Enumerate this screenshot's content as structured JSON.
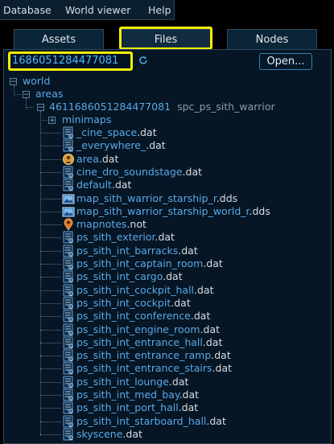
{
  "menu": [
    "Database",
    "World viewer",
    "Help"
  ],
  "tabs": [
    "Assets",
    "Files",
    "Nodes"
  ],
  "id_field": "1686051284477081",
  "open_label": "Open...",
  "tree": {
    "world": "world",
    "areas": "areas",
    "area_node": {
      "name": "4611686051284477081",
      "type": "spc_ps_sith_warrior"
    },
    "minimaps": "minimaps",
    "files": [
      {
        "stem": "_cine_space",
        "ext": ".dat",
        "icon": "scene-icon"
      },
      {
        "stem": "_everywhere_",
        "ext": ".dat",
        "icon": "scene-icon"
      },
      {
        "stem": "area",
        "ext": ".dat",
        "icon": "area-icon"
      },
      {
        "stem": "cine_dro_soundstage",
        "ext": ".dat",
        "icon": "scene-icon"
      },
      {
        "stem": "default",
        "ext": ".dat",
        "icon": "scene-icon"
      },
      {
        "stem": "map_sith_warrior_starship_r",
        "ext": ".dds",
        "icon": "image-icon"
      },
      {
        "stem": "map_sith_warrior_starship_world_r",
        "ext": ".dds",
        "icon": "image-icon"
      },
      {
        "stem": "mapnotes",
        "ext": ".not",
        "icon": "map-pin-icon"
      },
      {
        "stem": "ps_sith_exterior",
        "ext": ".dat",
        "icon": "scene-icon"
      },
      {
        "stem": "ps_sith_int_barracks",
        "ext": ".dat",
        "icon": "scene-icon"
      },
      {
        "stem": "ps_sith_int_captain_room",
        "ext": ".dat",
        "icon": "scene-icon"
      },
      {
        "stem": "ps_sith_int_cargo",
        "ext": ".dat",
        "icon": "scene-icon"
      },
      {
        "stem": "ps_sith_int_cockpit_hall",
        "ext": ".dat",
        "icon": "scene-icon"
      },
      {
        "stem": "ps_sith_int_cockpit",
        "ext": ".dat",
        "icon": "scene-icon"
      },
      {
        "stem": "ps_sith_int_conference",
        "ext": ".dat",
        "icon": "scene-icon"
      },
      {
        "stem": "ps_sith_int_engine_room",
        "ext": ".dat",
        "icon": "scene-icon"
      },
      {
        "stem": "ps_sith_int_entrance_hall",
        "ext": ".dat",
        "icon": "scene-icon"
      },
      {
        "stem": "ps_sith_int_entrance_ramp",
        "ext": ".dat",
        "icon": "scene-icon"
      },
      {
        "stem": "ps_sith_int_entrance_stairs",
        "ext": ".dat",
        "icon": "scene-icon"
      },
      {
        "stem": "ps_sith_int_lounge",
        "ext": ".dat",
        "icon": "scene-icon"
      },
      {
        "stem": "ps_sith_int_med_bay",
        "ext": ".dat",
        "icon": "scene-icon"
      },
      {
        "stem": "ps_sith_int_port_hall",
        "ext": ".dat",
        "icon": "scene-icon"
      },
      {
        "stem": "ps_sith_int_starboard_hall",
        "ext": ".dat",
        "icon": "scene-icon"
      },
      {
        "stem": "skyscene",
        "ext": ".dat",
        "icon": "scene-icon"
      }
    ]
  },
  "colors": {
    "highlight": "#f5f000",
    "accent_text": "#5aa8e8",
    "id_text": "#4fb8ff",
    "panel_bg": "#061624"
  }
}
